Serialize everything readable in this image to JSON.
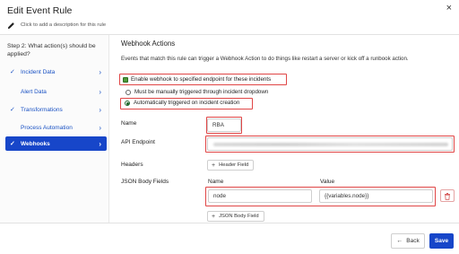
{
  "header": {
    "title": "Edit Event Rule",
    "description_placeholder": "Click to add a description for this rule",
    "close_glyph": "×"
  },
  "sidebar": {
    "step_text": "Step 2: What action(s) should be applied?",
    "items": [
      {
        "label": "Incident Data",
        "checked": true,
        "active": false
      },
      {
        "label": "Alert Data",
        "checked": false,
        "active": false
      },
      {
        "label": "Transformations",
        "checked": true,
        "active": false
      },
      {
        "label": "Process Automation",
        "checked": false,
        "active": false
      },
      {
        "label": "Webhooks",
        "checked": true,
        "active": true
      }
    ],
    "check_glyph": "✓",
    "chevron_glyph": "›"
  },
  "main": {
    "section_title": "Webhook Actions",
    "intro": "Events that match this rule can trigger a Webhook Action to do things like restart a server or kick off a runbook action.",
    "enable_label": "Enable webhook to specified endpoint for these incidents",
    "enable_checked": true,
    "radio_manual_label": "Must be manually triggered through incident dropdown",
    "radio_auto_label": "Automatically triggered on incident creation",
    "selected_trigger": "auto",
    "name_label": "Name",
    "name_value": "RBA",
    "endpoint_label": "API Endpoint",
    "endpoint_value": "",
    "headers_label": "Headers",
    "header_field_button": "Header Field",
    "json_label": "JSON Body Fields",
    "json_name_col": "Name",
    "json_value_col": "Value",
    "json_name_value": "node",
    "json_value_value": "{{variables.node}}",
    "json_field_button": "JSON Body Field"
  },
  "footer": {
    "back_label": "Back",
    "save_label": "Save"
  },
  "colors": {
    "accent": "#1746c9",
    "highlight": "#e04646",
    "checkbox": "#4f9a3b"
  }
}
